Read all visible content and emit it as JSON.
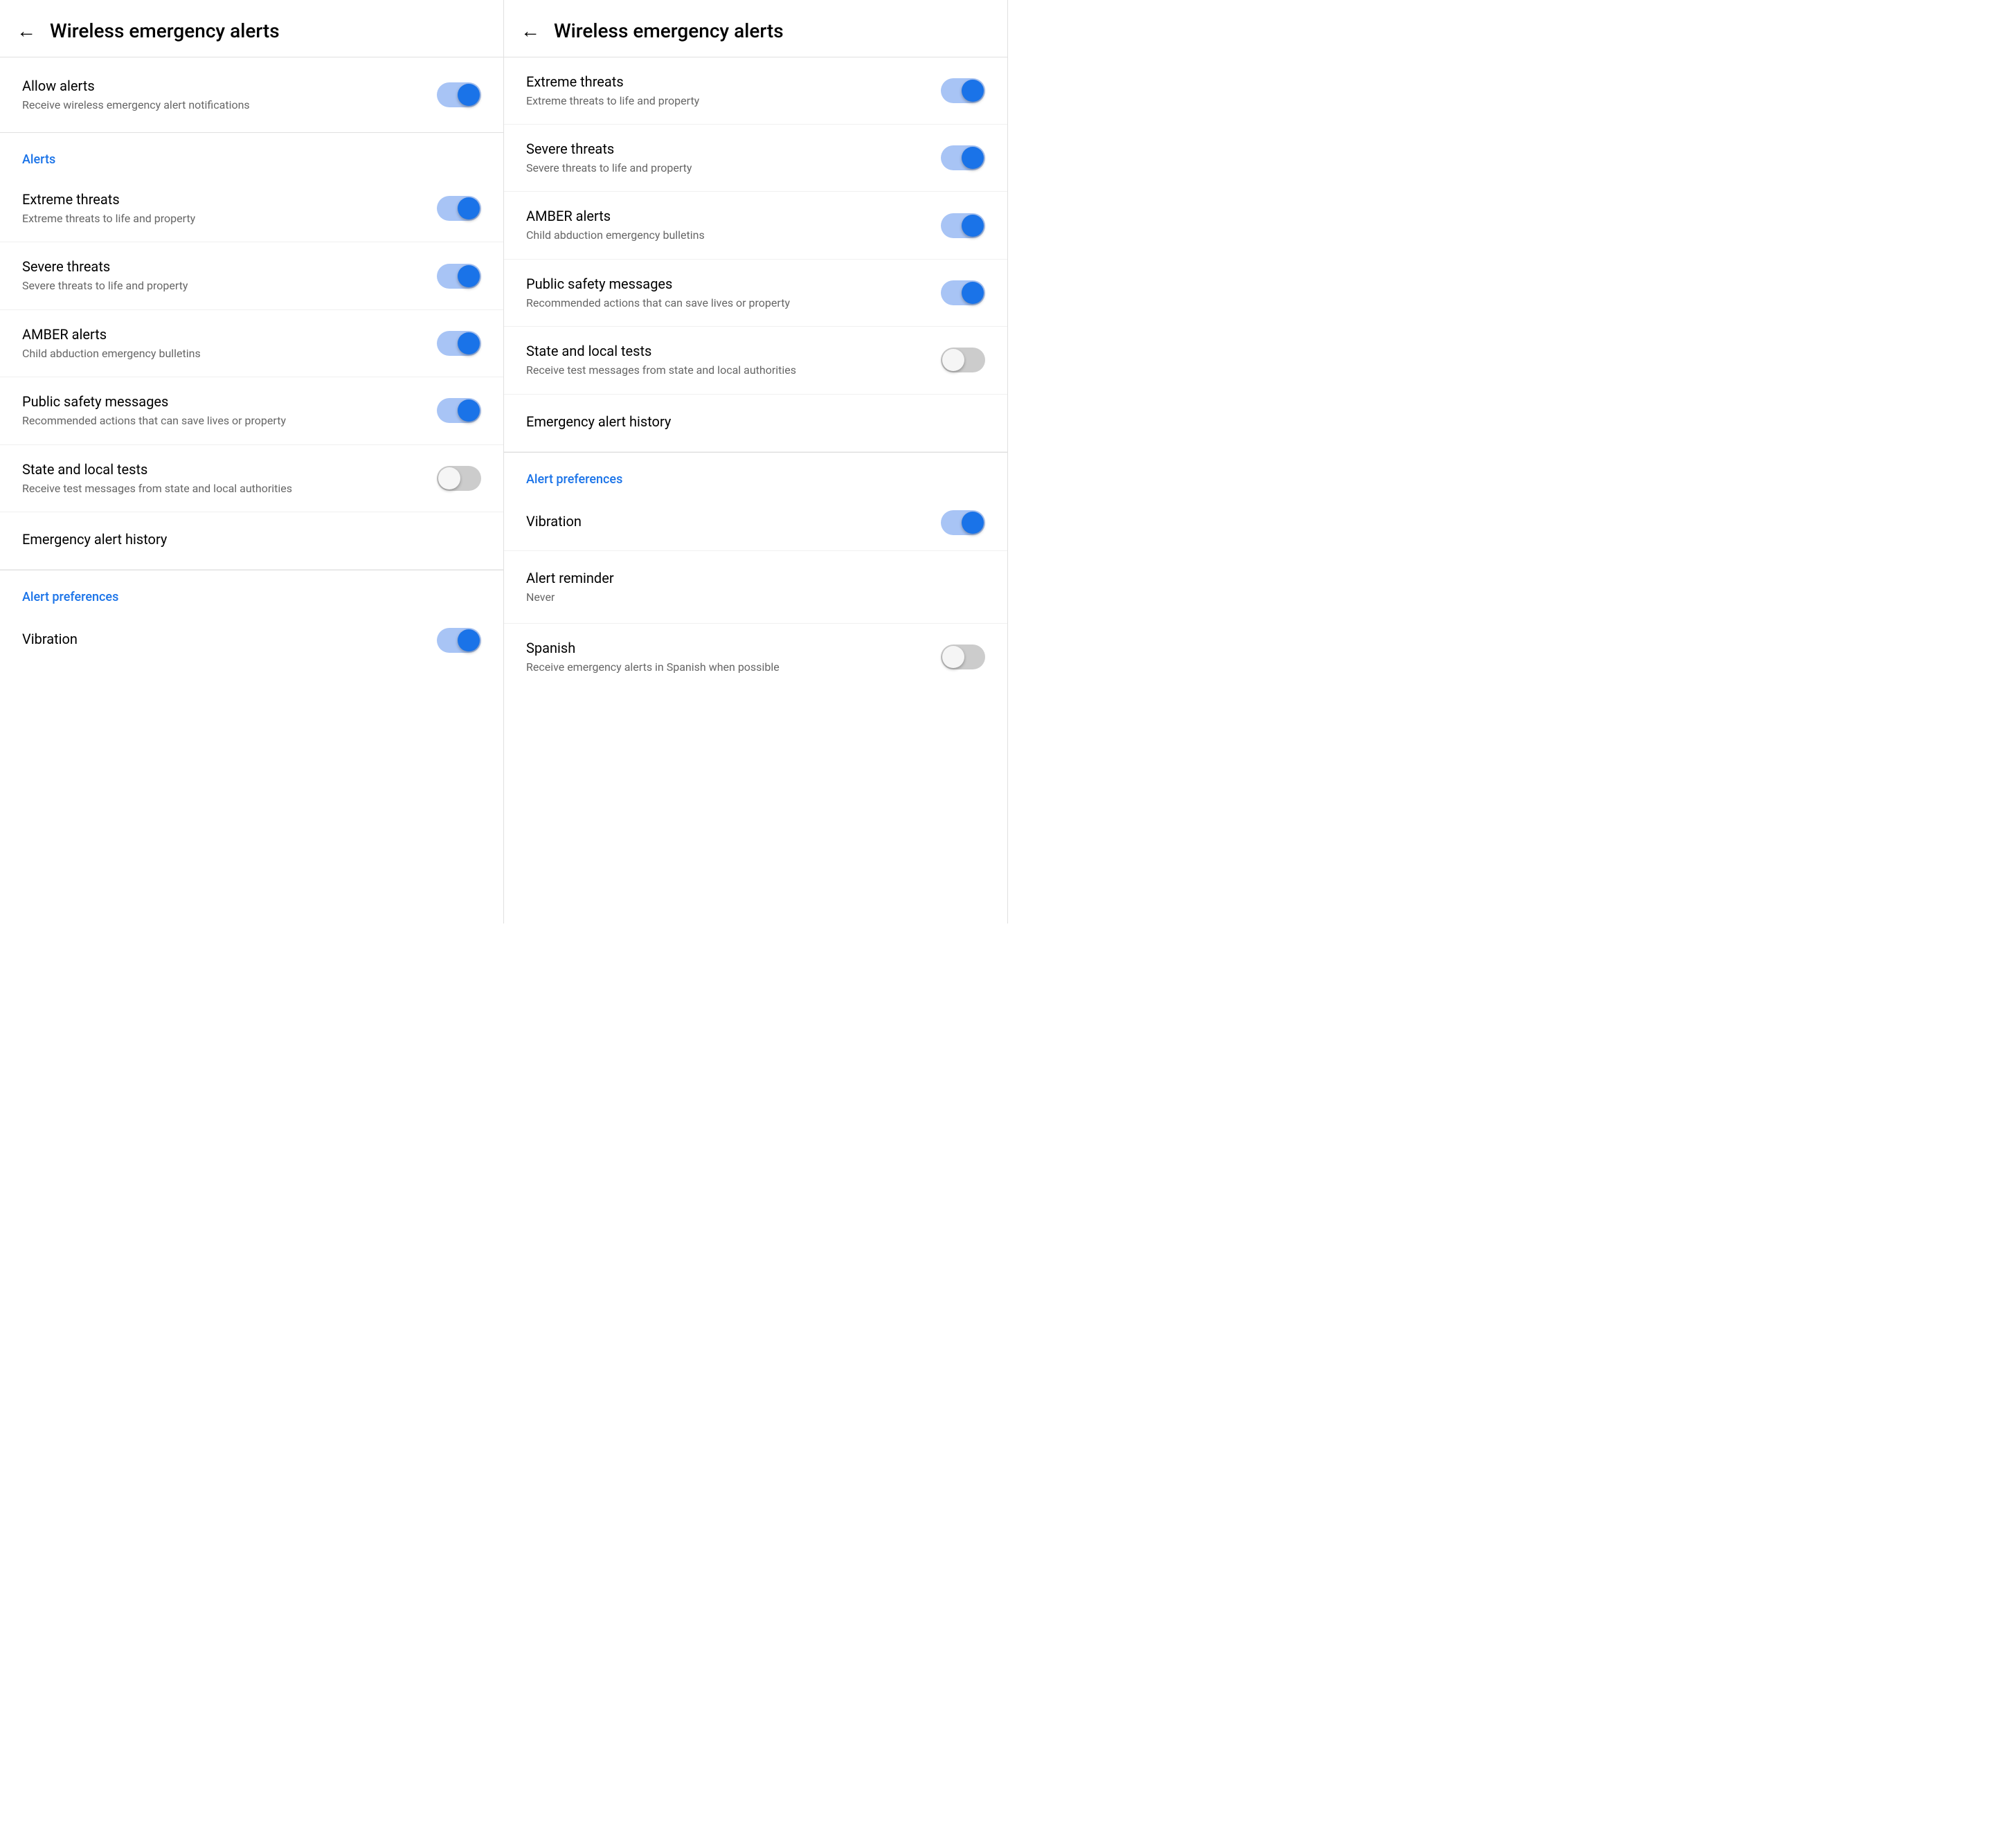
{
  "panels": [
    {
      "id": "panel-left",
      "header": {
        "back_label": "←",
        "title": "Wireless emergency alerts"
      },
      "allow_section": {
        "title": "Allow alerts",
        "desc": "Receive wireless emergency alert notifications",
        "toggle": "on"
      },
      "alerts_label": "Alerts",
      "alert_items": [
        {
          "title": "Extreme threats",
          "desc": "Extreme threats to life and property",
          "toggle": "on"
        },
        {
          "title": "Severe threats",
          "desc": "Severe threats to life and property",
          "toggle": "on"
        },
        {
          "title": "AMBER alerts",
          "desc": "Child abduction emergency bulletins",
          "toggle": "on"
        },
        {
          "title": "Public safety messages",
          "desc": "Recommended actions that can save lives or property",
          "toggle": "on"
        },
        {
          "title": "State and local tests",
          "desc": "Receive test messages from state and local authorities",
          "toggle": "off"
        }
      ],
      "history_item": "Emergency alert history",
      "preferences_label": "Alert preferences",
      "preference_items": [
        {
          "title": "Vibration",
          "desc": "",
          "toggle": "on"
        }
      ]
    },
    {
      "id": "panel-right",
      "header": {
        "back_label": "←",
        "title": "Wireless emergency alerts"
      },
      "alerts_label": "",
      "alert_items": [
        {
          "title": "Extreme threats",
          "desc": "Extreme threats to life and property",
          "toggle": "on"
        },
        {
          "title": "Severe threats",
          "desc": "Severe threats to life and property",
          "toggle": "on"
        },
        {
          "title": "AMBER alerts",
          "desc": "Child abduction emergency bulletins",
          "toggle": "on"
        },
        {
          "title": "Public safety messages",
          "desc": "Recommended actions that can save lives or property",
          "toggle": "on"
        },
        {
          "title": "State and local tests",
          "desc": "Receive test messages from state and local authorities",
          "toggle": "off"
        }
      ],
      "history_item": "Emergency alert history",
      "preferences_label": "Alert preferences",
      "preference_items": [
        {
          "title": "Vibration",
          "desc": "",
          "toggle": "on"
        },
        {
          "title": "Alert reminder",
          "desc": "Never",
          "toggle": null
        },
        {
          "title": "Spanish",
          "desc": "Receive emergency alerts in Spanish when possible",
          "toggle": "off"
        }
      ]
    }
  ]
}
